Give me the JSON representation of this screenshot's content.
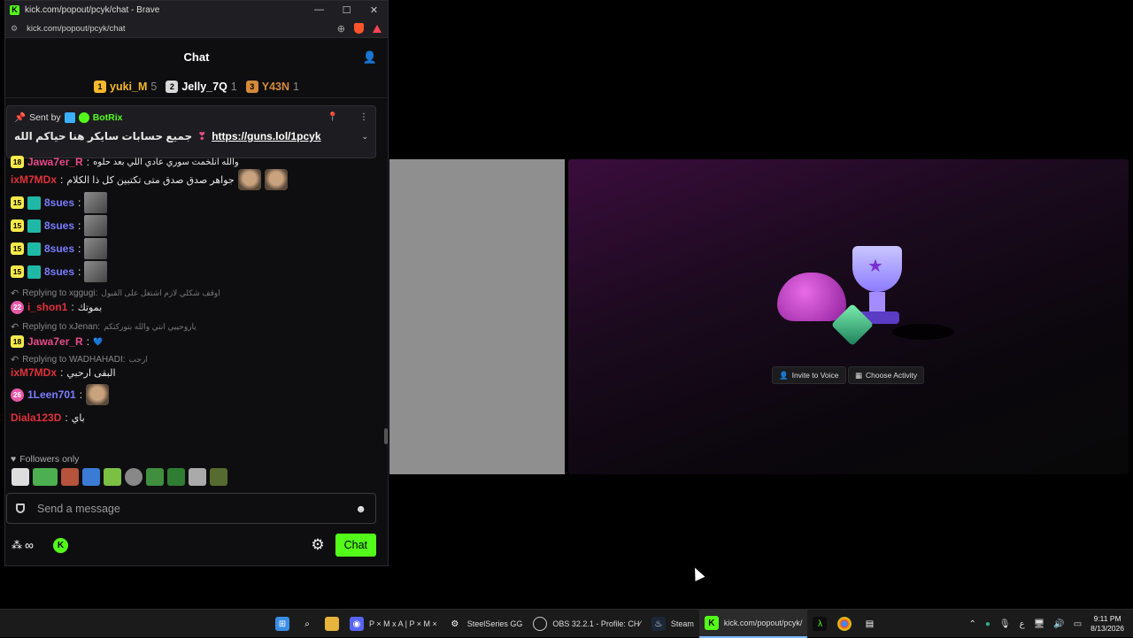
{
  "window": {
    "title": "kick.com/popout/pcyk/chat - Brave",
    "url": "kick.com/popout/pcyk/chat",
    "controls": [
      "—",
      "☐",
      "✕"
    ]
  },
  "chat": {
    "header": "Chat",
    "leaderboard": [
      {
        "rank": "1",
        "name": "yuki_M",
        "count": "5",
        "color": "#f5b92a"
      },
      {
        "rank": "2",
        "name": "Jelly_7Q",
        "count": "1",
        "color": "#d8d8d8"
      },
      {
        "rank": "3",
        "name": "Y43N",
        "count": "1",
        "color": "#d48a3a"
      }
    ],
    "pinned": {
      "sent_by": "Sent by",
      "bot_name": "BotRix",
      "text": "جميع حسابات سايكر هنا حياكم الله",
      "link": "https://guns.lol/1pcyk"
    },
    "messages": [
      {
        "badge": "18",
        "user": "Jawa7er_R",
        "user_color": "#e84a8a",
        "text": "والله انلخمت سوري عادي اللي بعد حلوه"
      },
      {
        "badge": "",
        "user": "ixM7MDx",
        "user_color": "#e0303a",
        "text": "جواهر صدق صدق متى تكتبين كل ذا الكلام"
      },
      {
        "badge": "15",
        "user": "8sues",
        "user_color": "#7a7cff",
        "text": ""
      },
      {
        "badge": "15",
        "user": "8sues",
        "user_color": "#7a7cff",
        "text": ""
      },
      {
        "badge": "15",
        "user": "8sues",
        "user_color": "#7a7cff",
        "text": ""
      },
      {
        "badge": "15",
        "user": "8sues",
        "user_color": "#7a7cff",
        "text": ""
      }
    ],
    "replies": [
      {
        "reply_to": "Replying to xggugi:",
        "reply_text": "اوقف شكلي لازم اشتغل على القبول",
        "badge": "22",
        "user": "i_shon1",
        "user_color": "#e0303a",
        "text": "بموتك"
      },
      {
        "reply_to": "Replying to xJenan:",
        "reply_text": "ياروحييي انتي والله بتوركتكم",
        "badge": "18",
        "user": "Jawa7er_R",
        "user_color": "#e84a8a",
        "text": "💙"
      },
      {
        "reply_to": "Replying to WADHAHADI:",
        "reply_text": "ارحب",
        "badge": "",
        "user": "ixM7MDx",
        "user_color": "#e0303a",
        "text": "البقى ارحبي"
      }
    ],
    "tail_messages": [
      {
        "badge": "26",
        "user": "1Leen701",
        "user_color": "#7a7cff",
        "text": ""
      },
      {
        "badge": "",
        "user": "Diala123D",
        "user_color": "#e0303a",
        "text": "باي"
      }
    ],
    "followers_only": "Followers only",
    "input_placeholder": "Send a message",
    "points": "∞",
    "send_button": "Chat"
  },
  "activity": {
    "invite_button": "Invite to Voice",
    "choose_button": "Choose Activity"
  },
  "taskbar": {
    "items": [
      {
        "label": "P × M x A | P × M ×",
        "icon": "discord-icon",
        "color": "#5865f2"
      },
      {
        "label": "SteelSeries GG",
        "icon": "steelseries-icon",
        "color": "#333"
      },
      {
        "label": "OBS 32.2.1 - Profile: CH⁄",
        "icon": "obs-icon",
        "color": "#333"
      },
      {
        "label": "Steam",
        "icon": "steam-icon",
        "color": "#1b2838"
      },
      {
        "label": "kick.com/popout/pcyk/",
        "icon": "kick-icon",
        "color": "#53fc18"
      }
    ],
    "time": "9:11 PM",
    "date": "8/13/2026",
    "lang": "ع"
  }
}
